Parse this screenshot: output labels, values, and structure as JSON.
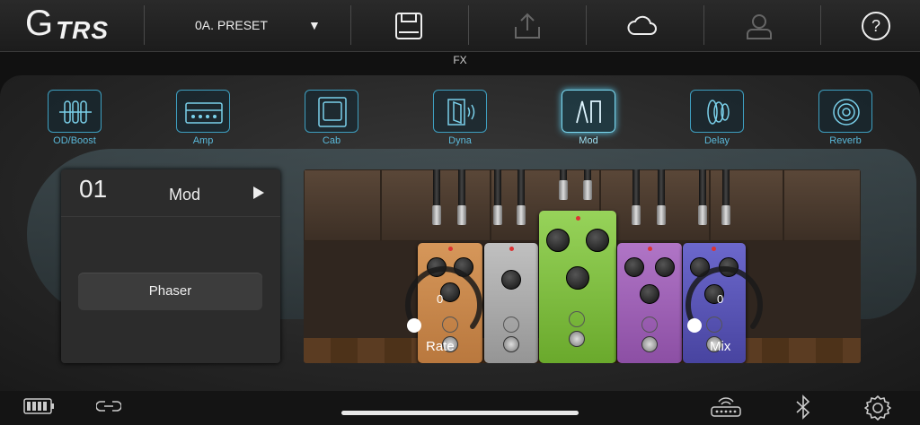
{
  "header": {
    "logo_text": "TRS",
    "logo_letter": "G",
    "preset_name": "0A. PRESET",
    "icons": [
      "save-icon",
      "upload-icon",
      "cloud-icon",
      "user-icon",
      "help-icon"
    ]
  },
  "fx_label": "FX",
  "fx_categories": [
    {
      "label": "OD/Boost",
      "icon": "od-boost-icon",
      "active": false
    },
    {
      "label": "Amp",
      "icon": "amp-icon",
      "active": false
    },
    {
      "label": "Cab",
      "icon": "cab-icon",
      "active": false
    },
    {
      "label": "Dyna",
      "icon": "dyna-icon",
      "active": false
    },
    {
      "label": "Mod",
      "icon": "mod-icon",
      "active": true
    },
    {
      "label": "Delay",
      "icon": "delay-icon",
      "active": false
    },
    {
      "label": "Reverb",
      "icon": "reverb-icon",
      "active": false
    }
  ],
  "slot": {
    "number": "01",
    "type": "Mod",
    "model": "Phaser"
  },
  "controls": [
    {
      "label": "Rate",
      "value": "0"
    },
    {
      "label": "Mix",
      "value": "0"
    }
  ],
  "colors": {
    "accent": "#3e9fc0",
    "pedal_orange": "#c98a4a",
    "pedal_gray": "#a9a9a9",
    "pedal_green": "#7dbb3c",
    "pedal_purple": "#9a5fb0",
    "pedal_blue": "#5a56b8"
  },
  "footer": {
    "icons": [
      "battery-icon",
      "link-icon",
      "router-icon",
      "bluetooth-icon",
      "settings-icon"
    ]
  }
}
